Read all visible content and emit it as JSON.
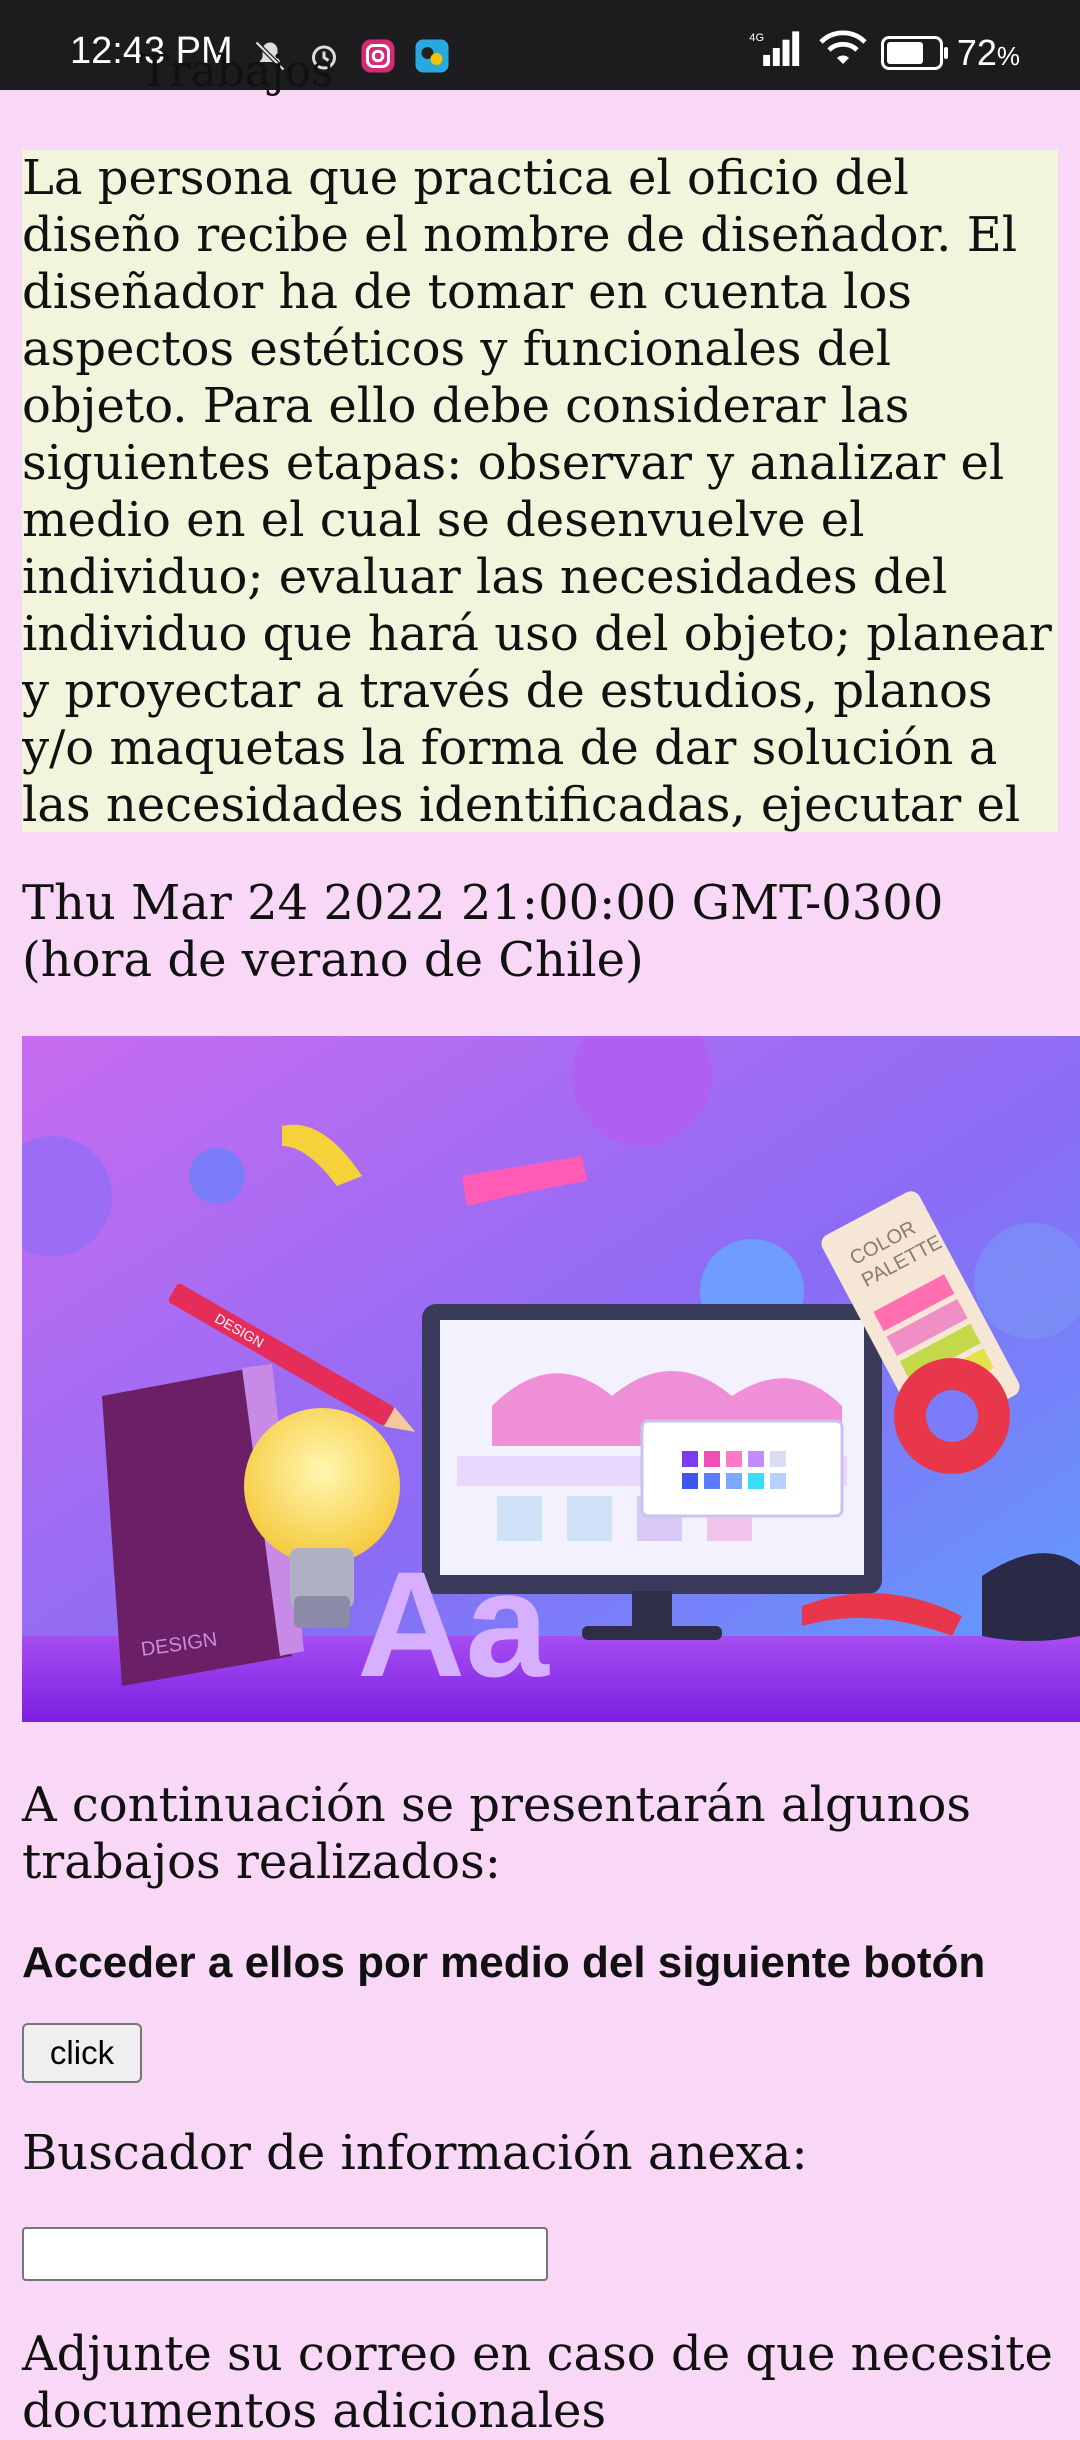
{
  "status_bar": {
    "time": "12:43 PM",
    "network": "4G",
    "battery": "72",
    "battery_unit": "%",
    "battery_level": 0.72
  },
  "page": {
    "cut_heading": "Trabajos",
    "intro": "La persona que practica el oficio del diseño recibe el nombre de diseñador. El diseñador ha de tomar en cuenta los aspectos estéticos y funcionales del objeto. Para ello debe considerar las siguientes etapas: observar y analizar el medio en el cual se desenvuelve el individuo; evaluar las necesidades del individuo que hará uso del objeto; planear y proyectar a través de estudios, planos y/o maquetas la forma de dar solución a las necesidades identificadas, ejecutar el proyecto.",
    "date": "Thu Mar 24 2022 21:00:00 GMT-0300 (hora de verano de Chile)",
    "hero_text": {
      "pencil_label": "DESIGN",
      "palette_label_1": "COLOR",
      "palette_label_2": "PALETTE",
      "book_label": "DESIGN",
      "letters": "Aa"
    },
    "works_text": "A continuación se presentarán algunos trabajos realizados:",
    "access_text": "Acceder a ellos por medio del siguiente botón",
    "button_label": "click",
    "search_label": "Buscador de información anexa:",
    "search_value": "",
    "mail_label": "Adjunte su correo en caso de que necesite documentos adicionales"
  }
}
